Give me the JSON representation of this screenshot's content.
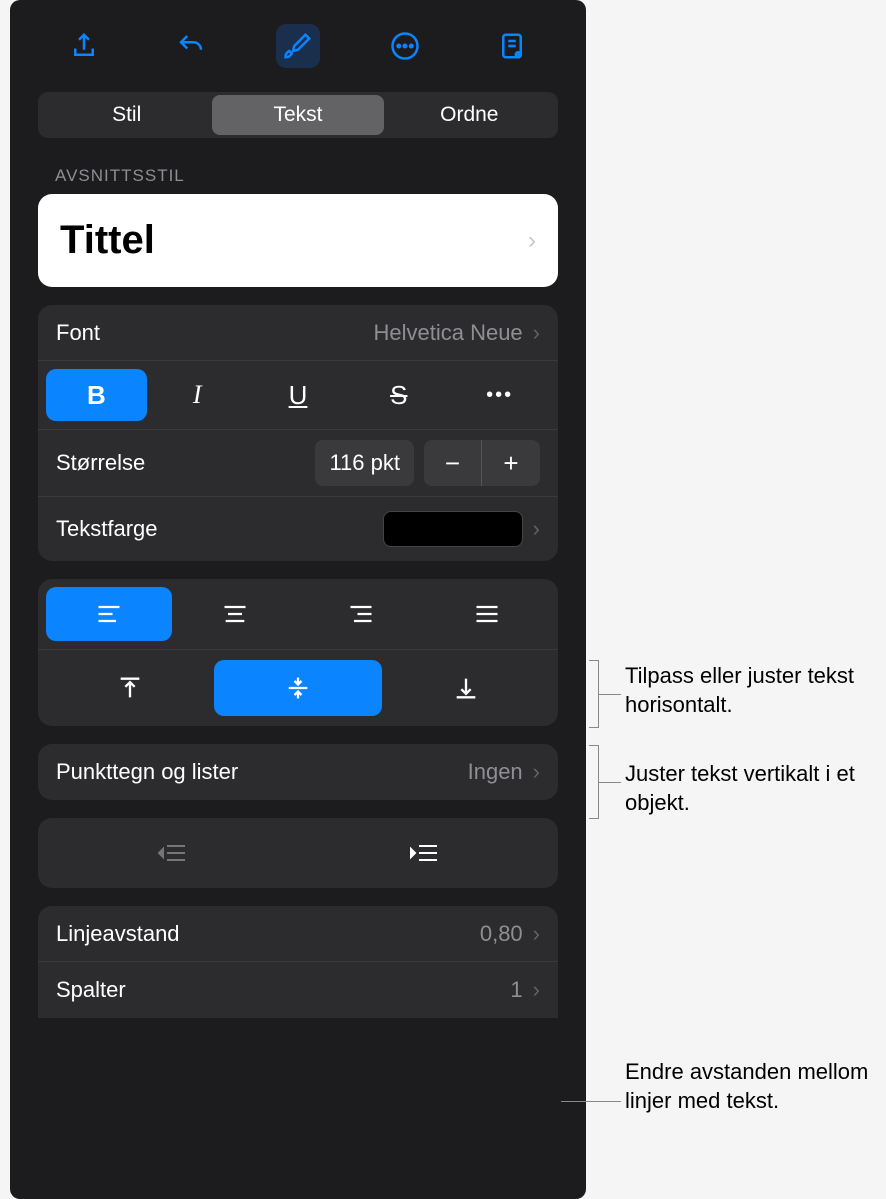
{
  "toolbar": {
    "share_icon": "share",
    "undo_icon": "undo",
    "format_icon": "brush",
    "more_icon": "more",
    "reader_icon": "reader"
  },
  "segmented": {
    "stil": "Stil",
    "tekst": "Tekst",
    "ordne": "Ordne"
  },
  "section_label": "AVSNITTSSTIL",
  "paragraph_style": "Tittel",
  "font": {
    "label": "Font",
    "value": "Helvetica Neue"
  },
  "style_buttons": {
    "bold": "B",
    "italic": "I",
    "underline": "U",
    "strike": "S",
    "more": "•••"
  },
  "size": {
    "label": "Størrelse",
    "value": "116 pkt",
    "minus": "−",
    "plus": "+"
  },
  "text_color": {
    "label": "Tekstfarge",
    "swatch": "#000000"
  },
  "bullets": {
    "label": "Punkttegn og lister",
    "value": "Ingen"
  },
  "line_spacing": {
    "label": "Linjeavstand",
    "value": "0,80"
  },
  "columns": {
    "label": "Spalter",
    "value": "1"
  },
  "callouts": {
    "halign": "Tilpass eller juster tekst horisontalt.",
    "valign": "Juster tekst vertikalt i et objekt.",
    "spacing": "Endre avstanden mellom linjer med tekst."
  }
}
